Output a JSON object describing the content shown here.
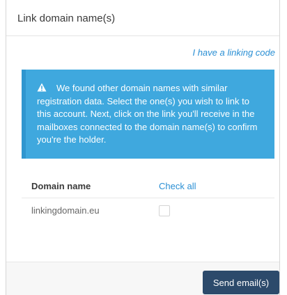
{
  "dialog": {
    "title": "Link domain name(s)",
    "linking_code_link": "I have a linking code"
  },
  "alert": {
    "icon": "warning-icon",
    "message": "We found other domain names with similar registration data. Select the one(s) you wish to link to this account. Next, click on the link you'll receive in the mailboxes connected to the domain name(s) to confirm you're the holder.",
    "background_color": "#3fa8de"
  },
  "table": {
    "columns": [
      "Domain name",
      "Check all"
    ],
    "rows": [
      {
        "domain": "linkingdomain.eu",
        "checked": false
      }
    ]
  },
  "footer": {
    "send_label": "Send email(s)",
    "button_color": "#2c4a6b"
  },
  "colors": {
    "link": "#2a8fd4",
    "text": "#3a3a3a"
  }
}
